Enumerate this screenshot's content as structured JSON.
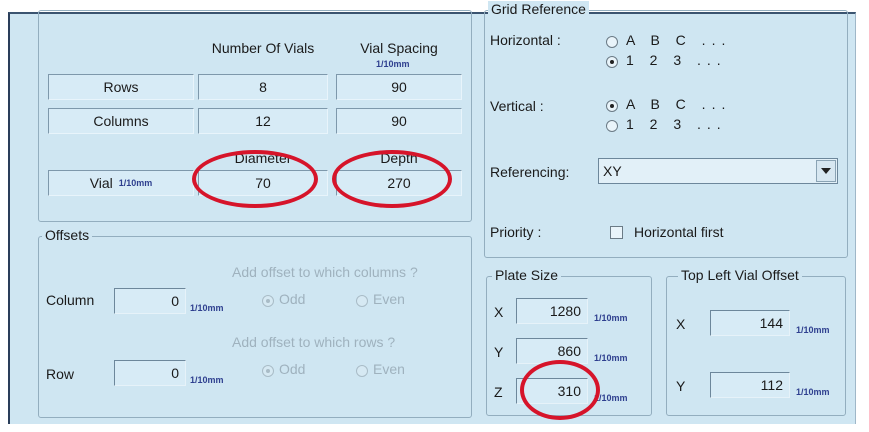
{
  "grid_reference": {
    "legend": "Grid Reference",
    "horizontal_label": "Horizontal :",
    "horizontal_options": [
      "A  B  C ...",
      "1  2  3 ..."
    ],
    "vertical_label": "Vertical :",
    "vertical_options": [
      "A  B  C ...",
      "1  2  3 ..."
    ],
    "referencing_label": "Referencing:",
    "referencing_value": "XY",
    "priority_label": "Priority :",
    "priority_checkbox_label": "Horizontal first"
  },
  "vials": {
    "col_headers": [
      "Number Of Vials",
      "Vial Spacing"
    ],
    "spacing_unit": "1/10mm",
    "rows_label": "Rows",
    "rows_count": "8",
    "rows_spacing": "90",
    "columns_label": "Columns",
    "columns_count": "12",
    "columns_spacing": "90",
    "diameter_header": "Diameter",
    "depth_header": "Depth",
    "vial_label": "Vial",
    "vial_unit": "1/10mm",
    "diameter_value": "70",
    "depth_value": "270"
  },
  "offsets": {
    "legend": "Offsets",
    "columns_question": "Add offset to which columns ?",
    "column_label": "Column",
    "column_value": "0",
    "column_unit": "1/10mm",
    "rows_question": "Add offset to which rows ?",
    "row_label": "Row",
    "row_value": "0",
    "row_unit": "1/10mm",
    "odd_label": "Odd",
    "even_label": "Even"
  },
  "plate_size": {
    "legend": "Plate Size",
    "x_label": "X",
    "x_value": "1280",
    "y_label": "Y",
    "y_value": "860",
    "z_label": "Z",
    "z_value": "310",
    "unit": "1/10mm"
  },
  "top_left_offset": {
    "legend": "Top Left Vial Offset",
    "x_label": "X",
    "x_value": "144",
    "y_label": "Y",
    "y_value": "112",
    "unit": "1/10mm"
  },
  "annotation_color": "#d6142a"
}
